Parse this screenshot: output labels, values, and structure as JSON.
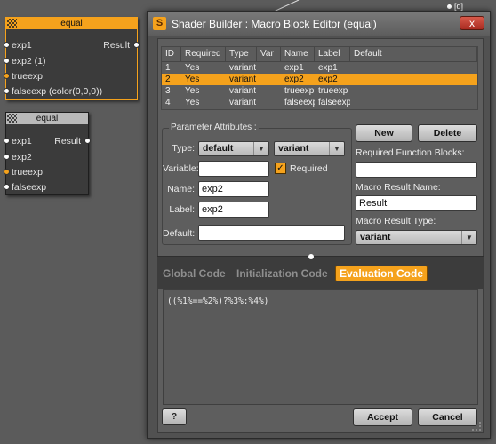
{
  "corner_label": "[d]",
  "nodes": [
    {
      "title": "equal",
      "ports": [
        "exp1",
        "exp2 (1)",
        "trueexp",
        "falseexp (color(0,0,0))"
      ],
      "output": "Result"
    },
    {
      "title": "equal",
      "ports": [
        "exp1",
        "exp2",
        "trueexp",
        "falseexp"
      ],
      "output": "Result"
    }
  ],
  "dialog": {
    "title": "Shader Builder : Macro Block Editor (equal)",
    "close_label": "x",
    "table": {
      "headers": [
        "ID",
        "Required",
        "Type",
        "Var",
        "Name",
        "Label",
        "Default"
      ],
      "rows": [
        {
          "id": "1",
          "required": "Yes",
          "type": "variant",
          "var": "",
          "name": "exp1",
          "label": "exp1",
          "default": ""
        },
        {
          "id": "2",
          "required": "Yes",
          "type": "variant",
          "var": "",
          "name": "exp2",
          "label": "exp2",
          "default": ""
        },
        {
          "id": "3",
          "required": "Yes",
          "type": "variant",
          "var": "",
          "name": "trueexp",
          "label": "trueexp",
          "default": ""
        },
        {
          "id": "4",
          "required": "Yes",
          "type": "variant",
          "var": "",
          "name": "falseexp",
          "label": "falseexp",
          "default": ""
        }
      ],
      "selected_row": 2
    },
    "param_attributes": {
      "title": "Parameter Attributes :",
      "type_label": "Type:",
      "type_value": "default",
      "type2_value": "variant",
      "variable_label": "Variable:",
      "variable_value": "",
      "required_label": "Required",
      "required_checked": true,
      "name_label": "Name:",
      "name_value": "exp2",
      "label_label": "Label:",
      "label_value": "exp2",
      "default_label": "Default:",
      "default_value": ""
    },
    "right_panel": {
      "new_label": "New",
      "delete_label": "Delete",
      "required_blocks_label": "Required Function Blocks:",
      "required_blocks_value": "",
      "result_name_label": "Macro Result Name:",
      "result_name_value": "Result",
      "result_type_label": "Macro Result Type:",
      "result_type_value": "variant"
    },
    "code_tabs": [
      "Global Code",
      "Initialization Code",
      "Evaluation Code"
    ],
    "active_tab": "Evaluation Code",
    "code": "((%1%==%2%)?%3%:%4%)",
    "help_label": "?",
    "accept_label": "Accept",
    "cancel_label": "Cancel"
  },
  "colors": {
    "accent": "#f5a21c",
    "background": "#5b5b5b",
    "panel": "#5e5e5e"
  }
}
